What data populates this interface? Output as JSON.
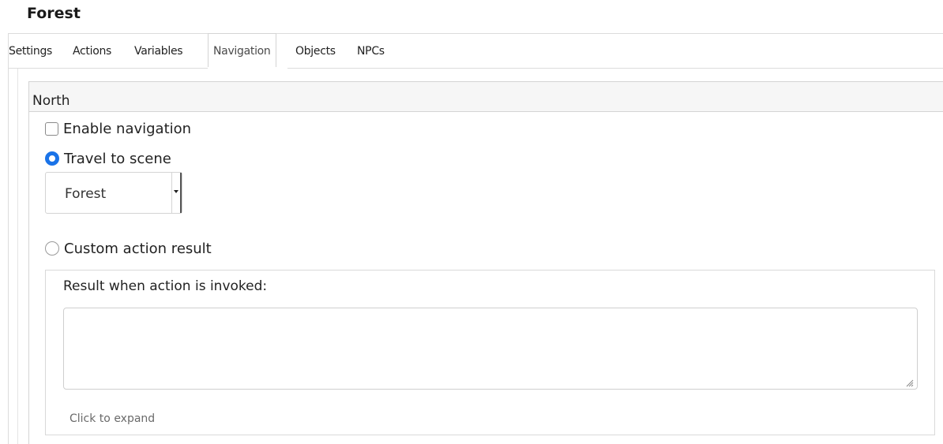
{
  "page": {
    "title": "Forest"
  },
  "tabs": [
    {
      "label": "Settings",
      "active": false
    },
    {
      "label": "Actions",
      "active": false
    },
    {
      "label": "Variables",
      "active": false
    },
    {
      "label": "Navigation",
      "active": true
    },
    {
      "label": "Objects",
      "active": false
    },
    {
      "label": "NPCs",
      "active": false
    }
  ],
  "direction": {
    "header": "North",
    "enable_navigation": {
      "label": "Enable navigation",
      "checked": false
    },
    "travel_to_scene": {
      "label": "Travel to scene",
      "selected": true
    },
    "scene_select": {
      "value": "Forest"
    },
    "custom_action": {
      "label": "Custom action result",
      "selected": false
    },
    "result": {
      "label": "Result when action is invoked:",
      "value": "",
      "expand_label": "Click to expand"
    }
  },
  "colors": {
    "accent": "#1a73e8",
    "border": "#d4d4d4",
    "header_bg": "#f6f6f6"
  }
}
